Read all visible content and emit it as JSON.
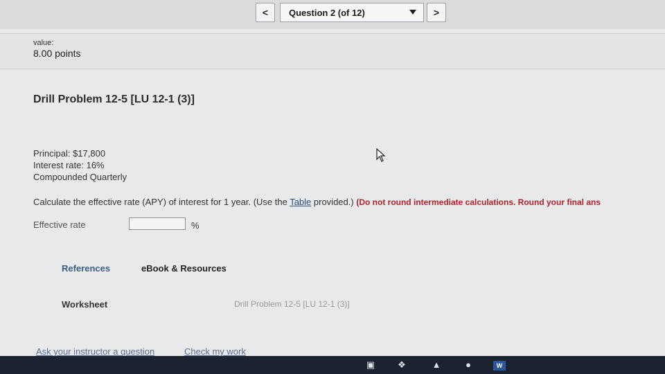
{
  "nav": {
    "prev_glyph": "<",
    "next_glyph": ">",
    "question_selector": "Question 2 (of 12)"
  },
  "value": {
    "label": "value:",
    "points": "8.00 points"
  },
  "problem": {
    "title": "Drill Problem 12-5 [LU 12-1 (3)]",
    "principal": "Principal: $17,800",
    "interest_rate": "Interest rate: 16%",
    "compounding": "Compounded Quarterly",
    "instruction_main": "Calculate the effective rate (APY) of interest for 1 year. (Use the ",
    "instruction_link": "Table",
    "instruction_after": " provided.) ",
    "instruction_warning": "(Do not round intermediate calculations. Round your final ans",
    "answer_label": "Effective rate",
    "answer_value": "",
    "answer_unit": "%"
  },
  "resources": {
    "references_tab": "References",
    "ebook_tab": "eBook & Resources",
    "worksheet_label": "Worksheet",
    "worksheet_value": "Drill Problem 12-5 [LU 12-1 (3)]"
  },
  "footer": {
    "ask_instructor": "Ask your instructor a question",
    "check_work": "Check my work"
  },
  "taskbar": {
    "icons": [
      "lock-icon",
      "dropbox-icon",
      "chevron-icon",
      "chrome-icon",
      "word-icon"
    ],
    "word_label": "W"
  },
  "colors": {
    "warning": "#b3232a",
    "link": "#3b5f8d"
  }
}
